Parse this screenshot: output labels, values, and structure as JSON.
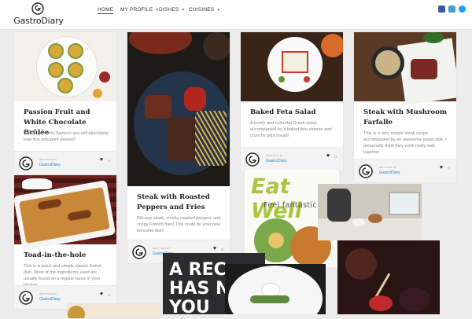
{
  "brand": {
    "name": "GastroDiary"
  },
  "nav": [
    {
      "label": "HOME",
      "active": true
    },
    {
      "label": "MY PROFILE",
      "dropdown": true
    },
    {
      "label": "DISHES",
      "dropdown": true
    },
    {
      "label": "CUISINES",
      "dropdown": true
    }
  ],
  "social": [
    {
      "icon": "facebook-icon",
      "color": "#3b5998"
    },
    {
      "icon": "instagram-icon",
      "color": "#4aa0c8"
    },
    {
      "icon": "twitter-icon",
      "color": "#1da1f2"
    }
  ],
  "cards": [
    {
      "title": "Passion Fruit and White Chocolate Brûlée",
      "desc": "If you like exotic flavours you will absolutely love this indulgent dessert!",
      "written_by": "WRITTEN BY",
      "author": "GastroDiary",
      "likes": "0"
    },
    {
      "title": "Steak with Roasted Peppers and Fries",
      "desc": "Rib-eye steak, smoky roasted peppers and crispy French fries! This could be your new favourite dish!",
      "written_by": "WRITTEN BY",
      "author": "GastroDiary",
      "likes": "0"
    },
    {
      "title": "Baked Feta Salad",
      "desc": "A lovely and colourful Greek salad accompanied by a baked feta cheese and crunchy pitta bread!",
      "written_by": "WRITTEN BY",
      "author": "GastroDiary",
      "likes": "0"
    },
    {
      "title": "Steak with Mushroom Farfalle",
      "desc": "This is a very simple steak recipe accompanied by an awesome pasta side. I personally think they work really well together.",
      "written_by": "WRITTEN BY",
      "author": "GastroDiary",
      "likes": "0"
    },
    {
      "title": "Toad-in-the-hole",
      "desc": "This is a quick and simple classic British dish. Most of the ingredients used are usually found on a regular basis in your kitchen.",
      "written_by": "WRITTEN BY",
      "author": "GastroDiary",
      "likes": "0"
    }
  ],
  "overlays": {
    "eatwell_title": "Eat Well",
    "eatwell_sub": "Feel fantastic",
    "poster_text": "A REC HAS NO YOU"
  },
  "colors": {
    "accent": "#2c84c7",
    "eatwell_green": "#a8c63c"
  }
}
